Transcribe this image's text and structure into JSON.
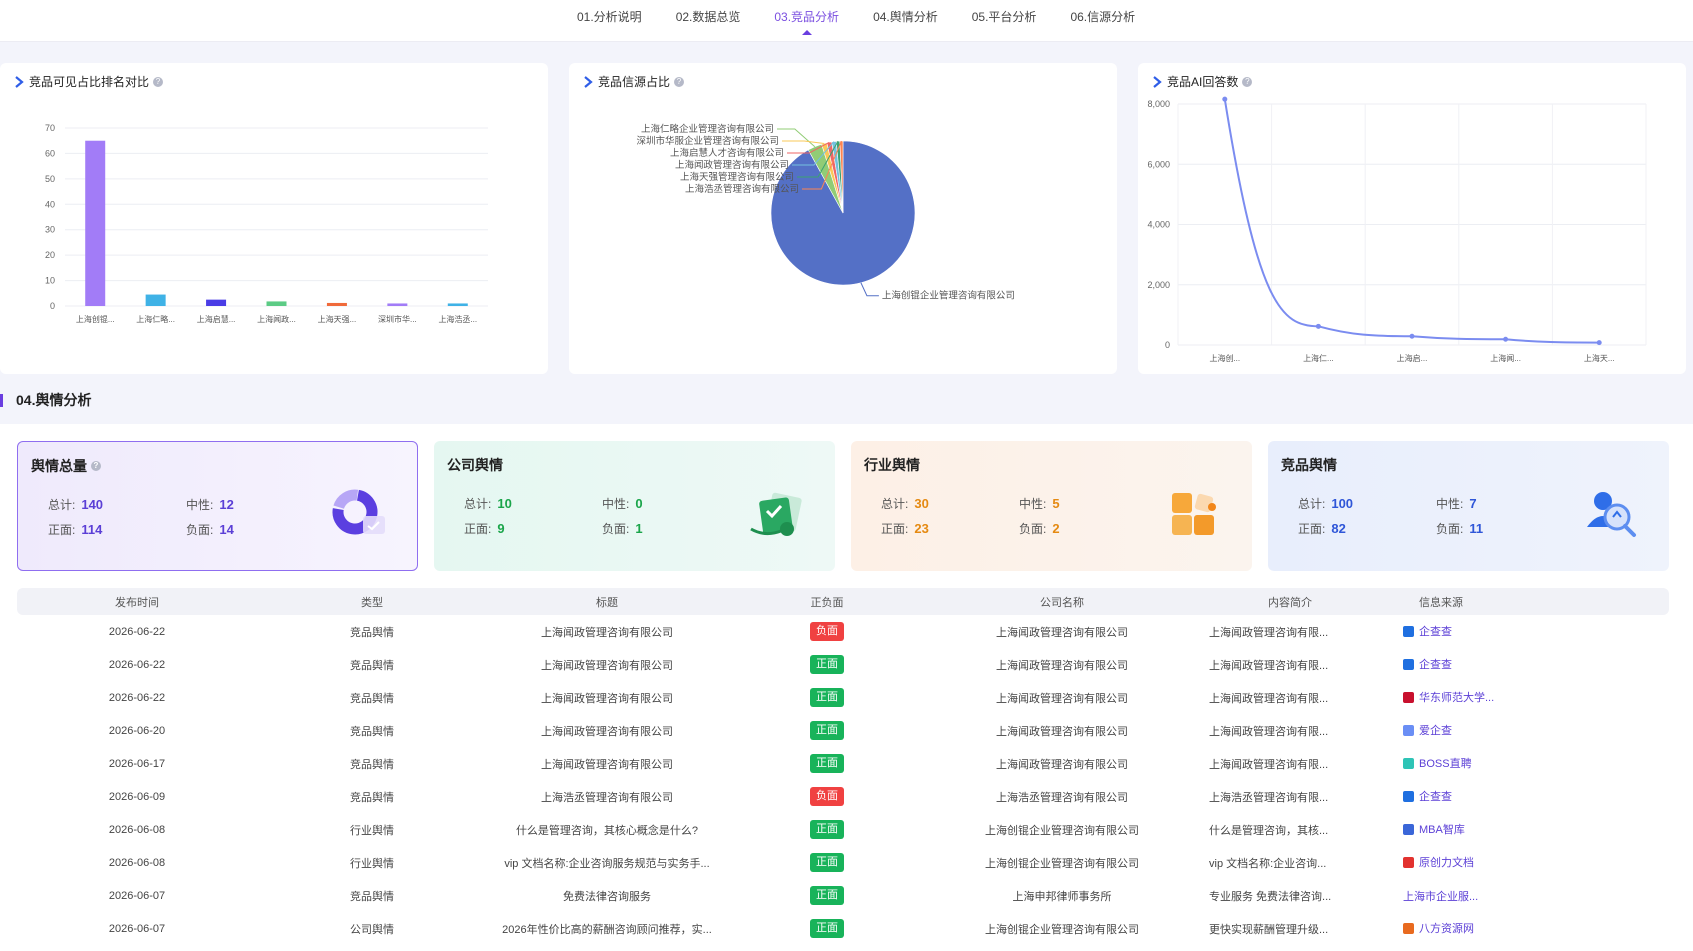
{
  "nav": {
    "tabs": [
      {
        "label": "01.分析说明"
      },
      {
        "label": "02.数据总览"
      },
      {
        "label": "03.竞品分析",
        "active": true
      },
      {
        "label": "04.舆情分析"
      },
      {
        "label": "05.平台分析"
      },
      {
        "label": "06.信源分析"
      }
    ]
  },
  "charts": {
    "bar_title": "竞品可见占比排名对比",
    "pie_title": "竞品信源占比",
    "line_title": "竞品AI回答数"
  },
  "chart_data": [
    {
      "type": "bar",
      "title": "竞品可见占比排名对比",
      "categories": [
        "上海创锟...",
        "上海仁略...",
        "上海启慧...",
        "上海闻政...",
        "上海天强...",
        "深圳市华...",
        "上海浩丞..."
      ],
      "values": [
        65,
        4.5,
        2.5,
        1.8,
        1.2,
        1.0,
        1.0
      ],
      "colors": [
        "#a27cf7",
        "#3fb2e6",
        "#4a3ce6",
        "#5ccb85",
        "#f06a3a",
        "#a27cf7",
        "#3fb2e6"
      ],
      "ylim": [
        0,
        70
      ],
      "yticks": [
        0,
        10,
        20,
        30,
        40,
        50,
        60,
        70
      ]
    },
    {
      "type": "pie",
      "title": "竞品信源占比",
      "slices": [
        {
          "label": "上海创锟企业管理咨询有限公司",
          "value": 92,
          "color": "#5470c6"
        },
        {
          "label": "上海仁略企业管理咨询有限公司",
          "value": 3.2,
          "color": "#91cc75"
        },
        {
          "label": "深圳市华服企业管理咨询有限公司",
          "value": 1.2,
          "color": "#fac858"
        },
        {
          "label": "上海启慧人才咨询有限公司",
          "value": 1.1,
          "color": "#ee6666"
        },
        {
          "label": "上海闻政管理咨询有限公司",
          "value": 1.0,
          "color": "#73c0de"
        },
        {
          "label": "上海天强管理咨询有限公司",
          "value": 0.8,
          "color": "#3ba272"
        },
        {
          "label": "上海浩丞管理咨询有限公司",
          "value": 0.7,
          "color": "#fc8452"
        }
      ]
    },
    {
      "type": "line",
      "title": "竞品AI回答数",
      "categories": [
        "上海创...",
        "上海仁...",
        "上海启...",
        "上海闻...",
        "上海天..."
      ],
      "values": [
        8200,
        620,
        290,
        190,
        80
      ],
      "ylim": [
        0,
        8000
      ],
      "yticks": [
        0,
        2000,
        4000,
        6000,
        8000
      ],
      "ytick_labels": [
        "0",
        "2,000",
        "4,000",
        "6,000",
        "8,000"
      ],
      "color": "#7b8cf0"
    }
  ],
  "section": {
    "title": "04.舆情分析"
  },
  "stats": [
    {
      "title": "舆情总量",
      "total_label": "总计:",
      "total": "140",
      "neutral_label": "中性:",
      "neutral": "12",
      "pos_label": "正面:",
      "pos": "114",
      "neg_label": "负面:",
      "neg": "14",
      "color": "#5b3fd6"
    },
    {
      "title": "公司舆情",
      "total_label": "总计:",
      "total": "10",
      "neutral_label": "中性:",
      "neutral": "0",
      "pos_label": "正面:",
      "pos": "9",
      "neg_label": "负面:",
      "neg": "1",
      "color": "#1aa54a"
    },
    {
      "title": "行业舆情",
      "total_label": "总计:",
      "total": "30",
      "neutral_label": "中性:",
      "neutral": "5",
      "pos_label": "正面:",
      "pos": "23",
      "neg_label": "负面:",
      "neg": "2",
      "color": "#e58a12"
    },
    {
      "title": "竞品舆情",
      "total_label": "总计:",
      "total": "100",
      "neutral_label": "中性:",
      "neutral": "7",
      "pos_label": "正面:",
      "pos": "82",
      "neg_label": "负面:",
      "neg": "11",
      "color": "#2f56d8"
    }
  ],
  "table": {
    "headers": [
      "发布时间",
      "类型",
      "标题",
      "正负面",
      "公司名称",
      "内容简介",
      "信息来源"
    ],
    "rows": [
      {
        "date": "2026-06-22",
        "type": "竞品舆情",
        "title": "上海闻政管理咨询有限公司",
        "sentiment": "负面",
        "company": "上海闻政管理咨询有限公司",
        "summary": "上海闻政管理咨询有限...",
        "source": "企查查",
        "src_color": "#1f6fe0"
      },
      {
        "date": "2026-06-22",
        "type": "竞品舆情",
        "title": "上海闻政管理咨询有限公司",
        "sentiment": "正面",
        "company": "上海闻政管理咨询有限公司",
        "summary": "上海闻政管理咨询有限...",
        "source": "企查查",
        "src_color": "#1f6fe0"
      },
      {
        "date": "2026-06-22",
        "type": "竞品舆情",
        "title": "上海闻政管理咨询有限公司",
        "sentiment": "正面",
        "company": "上海闻政管理咨询有限公司",
        "summary": "上海闻政管理咨询有限...",
        "source": "华东师范大学...",
        "src_color": "#c8102e"
      },
      {
        "date": "2026-06-20",
        "type": "竞品舆情",
        "title": "上海闻政管理咨询有限公司",
        "sentiment": "正面",
        "company": "上海闻政管理咨询有限公司",
        "summary": "上海闻政管理咨询有限...",
        "source": "爱企查",
        "src_color": "#6a8ef5"
      },
      {
        "date": "2026-06-17",
        "type": "竞品舆情",
        "title": "上海闻政管理咨询有限公司",
        "sentiment": "正面",
        "company": "上海闻政管理咨询有限公司",
        "summary": "上海闻政管理咨询有限...",
        "source": "BOSS直聘",
        "src_color": "#2ec4b6"
      },
      {
        "date": "2026-06-09",
        "type": "竞品舆情",
        "title": "上海浩丞管理咨询有限公司",
        "sentiment": "负面",
        "company": "上海浩丞管理咨询有限公司",
        "summary": "上海浩丞管理咨询有限...",
        "source": "企查查",
        "src_color": "#1f6fe0"
      },
      {
        "date": "2026-06-08",
        "type": "行业舆情",
        "title": "什么是管理咨询，其核心概念是什么?",
        "sentiment": "正面",
        "company": "上海创锟企业管理咨询有限公司",
        "summary": "什么是管理咨询，其核...",
        "source": "MBA智库",
        "src_color": "#3a66d8"
      },
      {
        "date": "2026-06-08",
        "type": "行业舆情",
        "title": "vip 文档名称:企业咨询服务规范与实务手...",
        "sentiment": "正面",
        "company": "上海创锟企业管理咨询有限公司",
        "summary": "vip 文档名称:企业咨询...",
        "source": "原创力文档",
        "src_color": "#e2322f"
      },
      {
        "date": "2026-06-07",
        "type": "竞品舆情",
        "title": "免费法律咨询服务",
        "sentiment": "正面",
        "company": "上海申邦律师事务所",
        "summary": "专业服务 免费法律咨询...",
        "source": "上海市企业服...",
        "src_color": ""
      },
      {
        "date": "2026-06-07",
        "type": "公司舆情",
        "title": "2026年性价比高的薪酬咨询顾问推荐，实...",
        "sentiment": "正面",
        "company": "上海创锟企业管理咨询有限公司",
        "summary": "更快实现薪酬管理升级...",
        "source": "八方资源网",
        "src_color": "#e86a1f"
      }
    ]
  }
}
